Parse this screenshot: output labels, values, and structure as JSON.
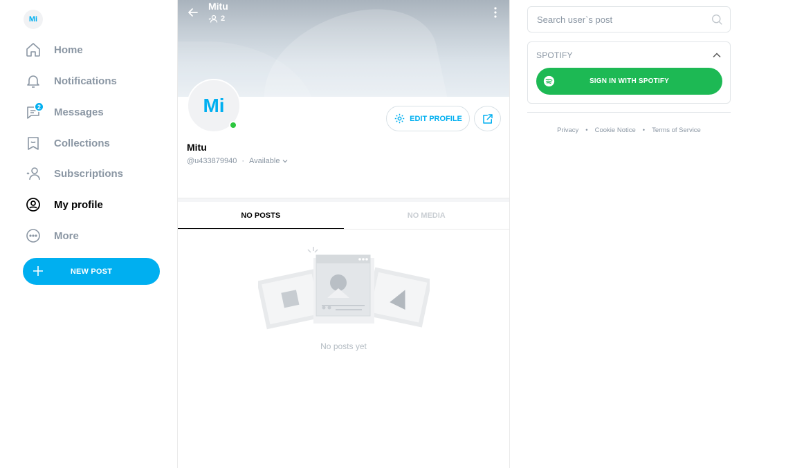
{
  "sidebar": {
    "avatar_initials": "Mi",
    "nav": [
      {
        "label": "Home",
        "icon": "home-icon"
      },
      {
        "label": "Notifications",
        "icon": "bell-icon"
      },
      {
        "label": "Messages",
        "icon": "chat-icon",
        "badge": "2"
      },
      {
        "label": "Collections",
        "icon": "bookmark-icon"
      },
      {
        "label": "Subscriptions",
        "icon": "subscriptions-icon"
      },
      {
        "label": "My profile",
        "icon": "profile-icon",
        "active": true
      },
      {
        "label": "More",
        "icon": "more-dots-icon"
      }
    ],
    "new_post_label": "NEW POST"
  },
  "profile": {
    "header_name": "Mitu",
    "fans_count": "2",
    "avatar_initials": "Mi",
    "name": "Mitu",
    "username": "@u433879940",
    "status": "Available",
    "edit_label": "EDIT PROFILE",
    "tabs": [
      {
        "label": "NO POSTS",
        "active": true
      },
      {
        "label": "NO MEDIA",
        "active": false
      }
    ],
    "empty_text": "No posts yet"
  },
  "right": {
    "search_placeholder": "Search user`s post",
    "spotify_title": "SPOTIFY",
    "spotify_button": "SIGN IN WITH SPOTIFY",
    "footer": [
      "Privacy",
      "Cookie Notice",
      "Terms of Service"
    ]
  },
  "colors": {
    "accent": "#00aff0",
    "online": "#2dc73f",
    "spotify": "#1db954",
    "muted": "#8a96a3"
  }
}
